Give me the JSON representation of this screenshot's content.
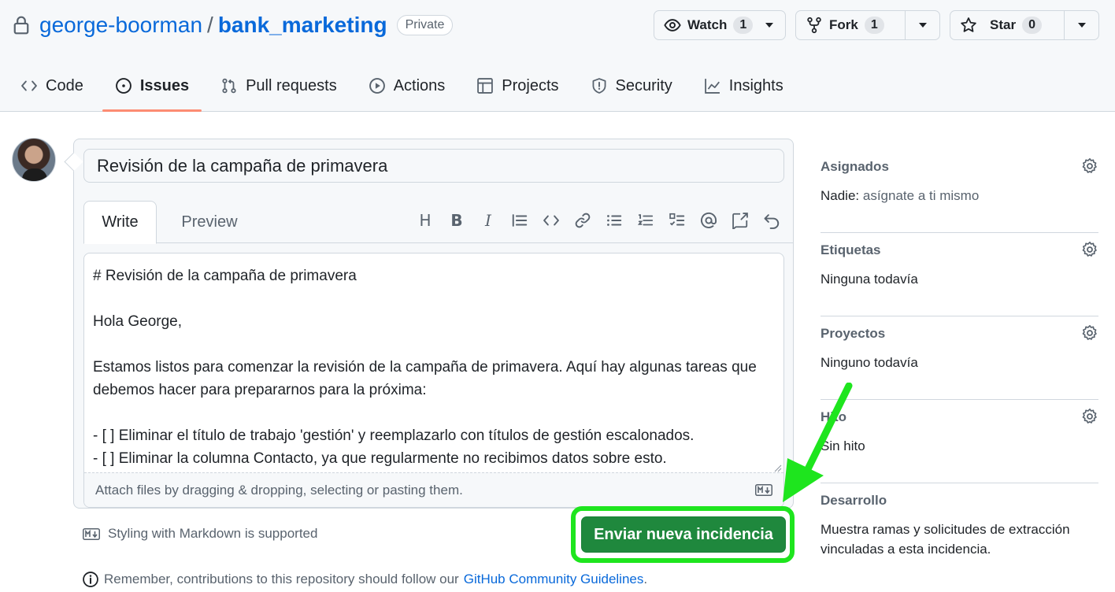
{
  "repo": {
    "owner": "george-boorman",
    "separator": "/",
    "name": "bank_marketing",
    "visibility": "Private"
  },
  "actions": {
    "watch": {
      "label": "Watch",
      "count": "1"
    },
    "fork": {
      "label": "Fork",
      "count": "1"
    },
    "star": {
      "label": "Star",
      "count": "0"
    }
  },
  "tabs": [
    {
      "label": "Code",
      "icon": "code-icon"
    },
    {
      "label": "Issues",
      "icon": "issue-opened-icon"
    },
    {
      "label": "Pull requests",
      "icon": "git-pull-request-icon"
    },
    {
      "label": "Actions",
      "icon": "play-icon"
    },
    {
      "label": "Projects",
      "icon": "table-icon"
    },
    {
      "label": "Security",
      "icon": "shield-icon"
    },
    {
      "label": "Insights",
      "icon": "graph-icon"
    }
  ],
  "active_tab": "Issues",
  "issue": {
    "title": "Revisión de la campaña de primavera",
    "editor_tabs": {
      "write": "Write",
      "preview": "Preview"
    },
    "body_lines": [
      "# Revisión de la campaña de primavera",
      "",
      "Hola George,",
      "",
      "Estamos listos para comenzar la revisión de la campaña de primavera. Aquí hay algunas tareas que debemos hacer para prepararnos para la próxima:",
      "",
      "- [ ] Eliminar el título de trabajo 'gestión' y reemplazarlo con títulos de gestión escalonados.",
      "- [ ] Eliminar la columna Contacto, ya que regularmente no recibimos datos sobre esto."
    ],
    "attach_hint": "Attach files by dragging & dropping, selecting or pasting them.",
    "markdown_note": "Styling with Markdown is supported",
    "submit_label": "Enviar nueva incidencia",
    "guidelines_prefix": "Remember, contributions to this repository should follow our",
    "guidelines_link": "GitHub Community Guidelines",
    "guidelines_suffix": "."
  },
  "toolbar_icons": [
    "heading-icon",
    "bold-icon",
    "italic-icon",
    "quote-icon",
    "code-icon",
    "link-icon",
    "unordered-list-icon",
    "ordered-list-icon",
    "task-list-icon",
    "mention-icon",
    "cross-reference-icon",
    "undo-icon"
  ],
  "toolbar_glyphs": {
    "heading": "H",
    "bold": "B",
    "italic": "I"
  },
  "sidebar": {
    "assignees": {
      "heading": "Asignados",
      "body_prefix": "Nadie:",
      "body_action": "asígnate a ti mismo"
    },
    "labels": {
      "heading": "Etiquetas",
      "body": "Ninguna todavía"
    },
    "projects": {
      "heading": "Proyectos",
      "body": "Ninguno todavía"
    },
    "milestone": {
      "heading": "Hito",
      "body": "Sin hito"
    },
    "development": {
      "heading": "Desarrollo",
      "body": "Muestra ramas y solicitudes de extracción vinculadas a esta incidencia."
    }
  },
  "colors": {
    "link": "#0969da",
    "primary_button": "#1f883d",
    "highlight": "#1ee51e",
    "tab_underline": "#fd8c73"
  }
}
